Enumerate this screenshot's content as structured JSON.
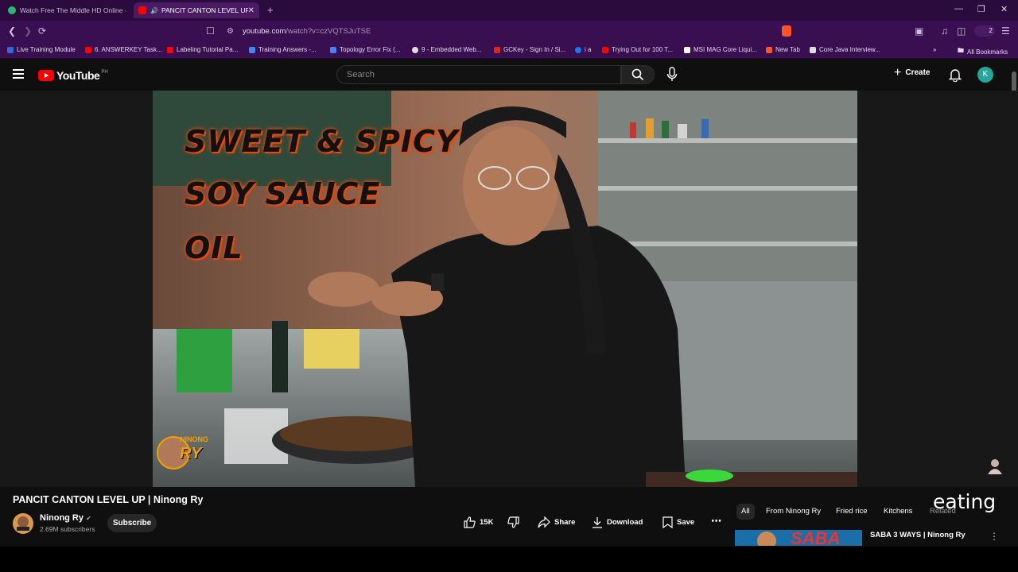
{
  "browser": {
    "tabs": [
      {
        "label": "Watch Free The Middle HD Online - "
      },
      {
        "label": "PANCIT CANTON LEVEL UP | "
      }
    ],
    "url_host": "youtube.com",
    "url_rest": "/watch?v=czVQTSJuTSE",
    "extensions_count": "2",
    "bookmarks": [
      {
        "label": "Live Training Module",
        "color": "#2f6bd8"
      },
      {
        "label": "6. ANSWERKEY Task...",
        "color": "#ff0000"
      },
      {
        "label": "Labeling Tutorial Pa...",
        "color": "#ff0000"
      },
      {
        "label": "Training Answers -...",
        "color": "#4285f4"
      },
      {
        "label": "Topology Error Fix (...",
        "color": "#4285f4"
      },
      {
        "label": "9 - Embedded Web...",
        "color": "#dddddd"
      },
      {
        "label": "GCKey - Sign In / Si...",
        "color": "#d52b1e"
      },
      {
        "label": "i a",
        "color": "#1877f2"
      },
      {
        "label": "Trying Out for 100 T...",
        "color": "#ff0000"
      },
      {
        "label": "MSI MAG Core Liqui...",
        "color": "#ffffff"
      },
      {
        "label": "New Tab",
        "color": "#fb542b"
      },
      {
        "label": "Core Java Interview...",
        "color": "#dddddd"
      }
    ],
    "all_bookmarks": "All Bookmarks"
  },
  "youtube": {
    "logo_text": "YouTube",
    "country_code": "PH",
    "search_placeholder": "Search",
    "create_label": "Create",
    "avatar_letter": "K"
  },
  "video": {
    "overlay_lines": [
      "SWEET & SPICY",
      "SOY SAUCE",
      "OIL"
    ],
    "watermark_top": "NINONG",
    "watermark_bottom": "RY",
    "title": "PANCIT CANTON LEVEL UP | Ninong Ry",
    "channel_name": "Ninong Ry",
    "subscribers": "2.69M subscribers",
    "subscribe_label": "Subscribe",
    "likes": "15K",
    "share_label": "Share",
    "download_label": "Download",
    "save_label": "Save"
  },
  "sidebar": {
    "chips": [
      "All",
      "From Ninong Ry",
      "Fried rice",
      "Kitchens",
      "Related"
    ],
    "overlay_text": "eating",
    "recommendation": {
      "title": "SABA 3 WAYS | Ninong Ry",
      "thumb_text": "SABA"
    }
  }
}
